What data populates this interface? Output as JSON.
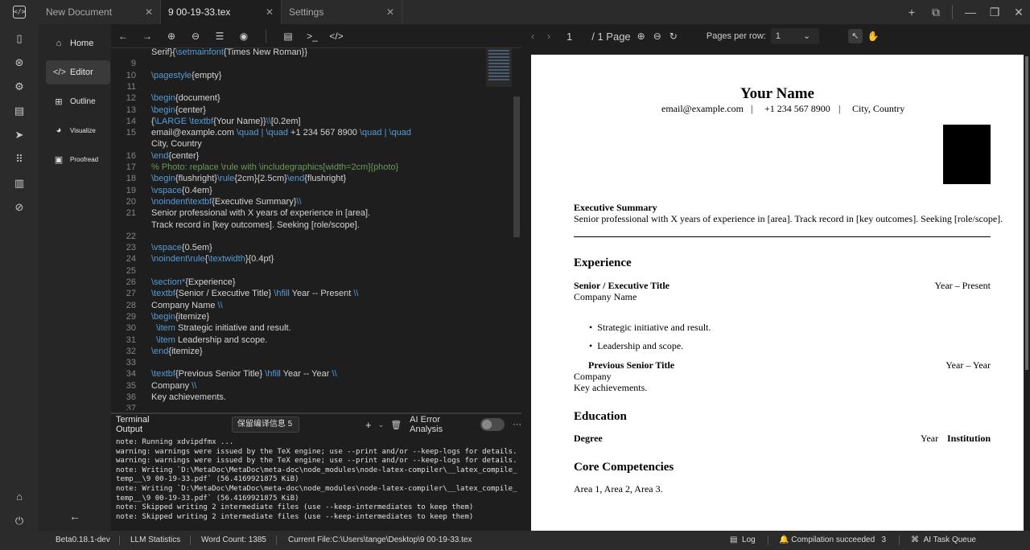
{
  "tabs": [
    {
      "label": "New Document"
    },
    {
      "label": "9 00-19-33.tex"
    },
    {
      "label": "Settings"
    }
  ],
  "nav": {
    "home": "Home",
    "editor": "Editor",
    "outline": "Outline",
    "visualize": "Visualize",
    "proofread": "Proofread"
  },
  "code_lines": [
    {
      "n": "",
      "t": "Serif}{\\setmainfont{Times New Roman}}"
    },
    {
      "n": "9",
      "t": ""
    },
    {
      "n": "10",
      "t": "\\pagestyle{empty}"
    },
    {
      "n": "11",
      "t": ""
    },
    {
      "n": "12",
      "t": "\\begin{document}"
    },
    {
      "n": "13",
      "t": "\\begin{center}"
    },
    {
      "n": "14",
      "t": "{\\LARGE \\textbf{Your Name}}\\\\[0.2em]"
    },
    {
      "n": "15",
      "t": "email@example.com \\quad | \\quad +1 234 567 8900 \\quad | \\quad"
    },
    {
      "n": "",
      "t": "City, Country"
    },
    {
      "n": "16",
      "t": "\\end{center}"
    },
    {
      "n": "17",
      "t": "% Photo: replace \\rule with \\includegraphics[width=2cm]{photo}"
    },
    {
      "n": "18",
      "t": "\\begin{flushright}\\rule{2cm}{2.5cm}\\end{flushright}"
    },
    {
      "n": "19",
      "t": "\\vspace{0.4em}"
    },
    {
      "n": "20",
      "t": "\\noindent\\textbf{Executive Summary}\\\\"
    },
    {
      "n": "21",
      "t": "Senior professional with X years of experience in [area]."
    },
    {
      "n": "",
      "t": "Track record in [key outcomes]. Seeking [role/scope]."
    },
    {
      "n": "22",
      "t": ""
    },
    {
      "n": "23",
      "t": "\\vspace{0.5em}"
    },
    {
      "n": "24",
      "t": "\\noindent\\rule{\\textwidth}{0.4pt}"
    },
    {
      "n": "25",
      "t": ""
    },
    {
      "n": "26",
      "t": "\\section*{Experience}"
    },
    {
      "n": "27",
      "t": "\\textbf{Senior / Executive Title} \\hfill Year -- Present \\\\"
    },
    {
      "n": "28",
      "t": "Company Name \\\\"
    },
    {
      "n": "29",
      "t": "\\begin{itemize}"
    },
    {
      "n": "30",
      "t": "  \\item Strategic initiative and result."
    },
    {
      "n": "31",
      "t": "  \\item Leadership and scope."
    },
    {
      "n": "32",
      "t": "\\end{itemize}"
    },
    {
      "n": "33",
      "t": ""
    },
    {
      "n": "34",
      "t": "\\textbf{Previous Senior Title} \\hfill Year -- Year \\\\"
    },
    {
      "n": "35",
      "t": "Company \\\\"
    },
    {
      "n": "36",
      "t": "Key achievements."
    },
    {
      "n": "37",
      "t": ""
    }
  ],
  "terminal": {
    "title": "Terminal Output",
    "select": "保留编译信息 5",
    "ai_label": "AI Error Analysis",
    "lines": [
      "note: Running xdvipdfmx ...",
      "warning: warnings were issued by the TeX engine; use --print and/or --keep-logs for details.",
      "warning: warnings were issued by the TeX engine; use --print and/or --keep-logs for details.",
      "note: Writing `D:\\MetaDoc\\MetaDoc\\meta-doc\\node_modules\\node-latex-compiler\\__latex_compile_",
      "temp__\\9 00-19-33.pdf` (56.4169921875 KiB)",
      "note: Writing `D:\\MetaDoc\\MetaDoc\\meta-doc\\node_modules\\node-latex-compiler\\__latex_compile_",
      "temp__\\9 00-19-33.pdf` (56.4169921875 KiB)",
      "note: Skipped writing 2 intermediate files (use --keep-intermediates to keep them)",
      "note: Skipped writing 2 intermediate files (use --keep-intermediates to keep them)"
    ]
  },
  "pdf_toolbar": {
    "page": "1",
    "total": "/ 1 Page",
    "pages_per_row_label": "Pages per row:",
    "pages_per_row": "1"
  },
  "pdf": {
    "name": "Your Name",
    "contact": {
      "email": "email@example.com",
      "sep": "|",
      "phone": "+1 234 567 8900",
      "city": "City, Country"
    },
    "summary_title": "Executive Summary",
    "summary_text": "Senior professional with X years of experience in [area]. Track record in [key outcomes]. Seeking [role/scope].",
    "experience_title": "Experience",
    "job1_title": "Senior / Executive Title",
    "job1_dates": "Year – Present",
    "job1_company": "Company Name",
    "bullets": [
      "Strategic initiative and result.",
      "Leadership and scope."
    ],
    "job2_title": "Previous Senior Title",
    "job2_dates": "Year – Year",
    "job2_company": "Company",
    "job2_desc": "Key achievements.",
    "education_title": "Education",
    "degree": "Degree",
    "edu_year": "Year",
    "institution": "Institution",
    "core_title": "Core Competencies",
    "core_text": "Area 1, Area 2, Area 3."
  },
  "status": {
    "version": "Beta0.18.1-dev",
    "llm": "LLM Statistics",
    "words": "Word Count: 1385",
    "file": "Current File:C:\\Users\\tange\\Desktop\\9 00-19-33.tex",
    "log": "Log",
    "compile": "Compilation succeeded",
    "compile_count": "3",
    "queue": "AI Task Queue"
  }
}
